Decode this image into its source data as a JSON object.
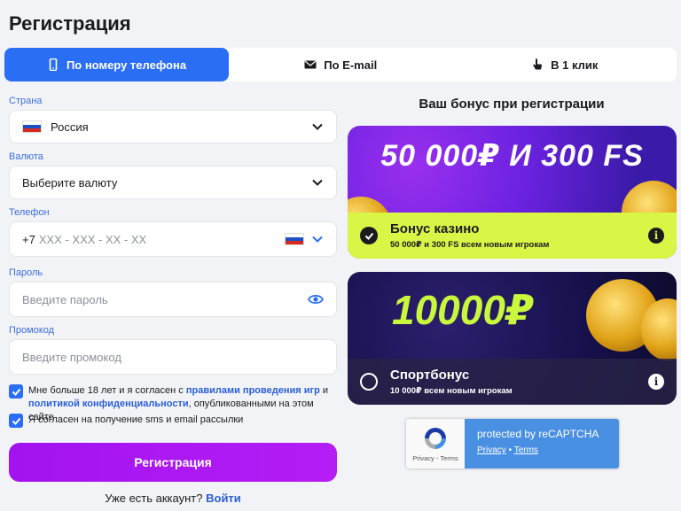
{
  "page_title": "Регистрация",
  "tabs": [
    {
      "label": "По номеру телефона",
      "icon": "phone-icon",
      "active": true
    },
    {
      "label": "По E-mail",
      "icon": "envelope-icon",
      "active": false
    },
    {
      "label": "В 1 клик",
      "icon": "pointer-icon",
      "active": false
    }
  ],
  "form": {
    "country_label": "Страна",
    "country_value": "Россия",
    "currency_label": "Валюта",
    "currency_placeholder": "Выберите валюту",
    "phone_label": "Телефон",
    "phone_prefix": "+7",
    "phone_placeholder": "XXX - XXX - XX - XX",
    "password_label": "Пароль",
    "password_placeholder": "Введите пароль",
    "promo_label": "Промокод",
    "promo_placeholder": "Введите промокод",
    "agree_text_1": "Мне больше 18 лет и я согласен с ",
    "agree_link_1": "правилами проведения игр",
    "agree_text_2": " и ",
    "agree_link_2": "политикой конфиденциальности",
    "agree_text_3": ", опубликованными на этом сайте",
    "sms_text": "Я согласен на получение sms и email рассылки",
    "submit_label": "Регистрация",
    "have_account": "Уже есть аккаунт?",
    "login_link": "Войти"
  },
  "bonus": {
    "title": "Ваш бонус при регистрации",
    "cards": [
      {
        "headline": "50 000₽ И 300 FS",
        "name": "Бонус казино",
        "desc": "50 000₽ и 300 FS всем новым игрокам",
        "selected": true
      },
      {
        "headline": "10000₽",
        "name": "Спортбонус",
        "desc": "10 000₽ всем новым игрокам",
        "selected": false
      }
    ]
  },
  "captcha": {
    "protected": "protected by reCAPTCHA",
    "privacy": "Privacy",
    "terms": "Terms",
    "small_privacy_terms": "Privacy - Terms"
  },
  "colors": {
    "accent": "#2a6ef6",
    "submit": "#a213f0",
    "lime": "#d9f546"
  }
}
